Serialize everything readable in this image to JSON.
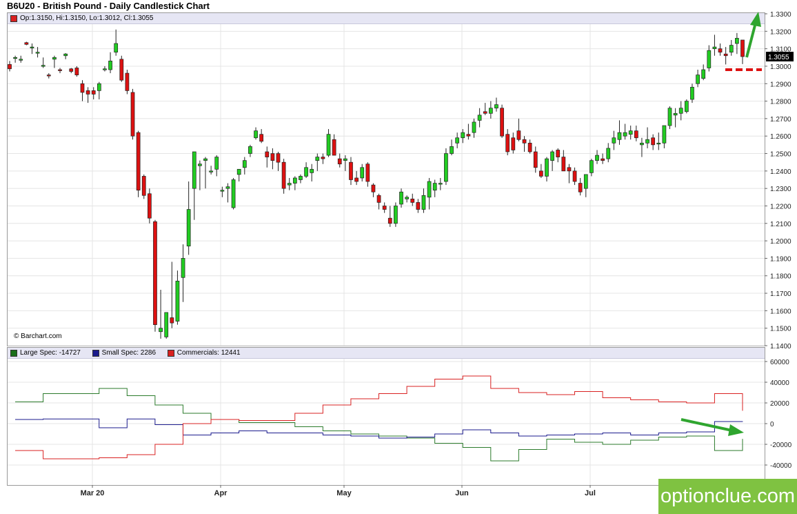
{
  "header": {
    "title": "B6U20 - British Pound - Daily Candlestick Chart"
  },
  "price_legend": {
    "label": "Op:1.3150, Hi:1.3150, Lo:1.3012, Cl:1.3055",
    "color": "#d92020"
  },
  "last_price_label": "1.3055",
  "copyright": "© Barchart.com",
  "cot_legend": [
    {
      "label": "Large Spec: -14727",
      "color": "#1a6e1a"
    },
    {
      "label": "Small Spec: 2286",
      "color": "#1a1a8c"
    },
    {
      "label": "Commercials: 12441",
      "color": "#d92020"
    }
  ],
  "brand": "optionclue.com",
  "colors": {
    "up": "#22cc22",
    "down": "#dd1111",
    "large": "#2a7a2a",
    "small": "#1a1a8c",
    "comm": "#d92020",
    "arrow": "#2fa52f"
  },
  "chart_data": [
    {
      "type": "candlestick",
      "x_tick_labels": [
        "Mar 20",
        "Apr",
        "May",
        "Jun",
        "Jul"
      ],
      "y_ticks": [
        "1.3300",
        "1.3200",
        "1.3100",
        "1.3000",
        "1.2900",
        "1.2800",
        "1.2700",
        "1.2600",
        "1.2500",
        "1.2400",
        "1.2300",
        "1.2200",
        "1.2100",
        "1.2000",
        "1.1900",
        "1.1800",
        "1.1700",
        "1.1600",
        "1.1500",
        "1.1400"
      ],
      "ylim": [
        1.14,
        1.33
      ],
      "candles": [
        {
          "o": 1.301,
          "h": 1.303,
          "l": 1.297,
          "c": 1.2985
        },
        {
          "o": 1.3045,
          "h": 1.306,
          "l": 1.302,
          "c": 1.305
        },
        {
          "o": 1.3035,
          "h": 1.306,
          "l": 1.302,
          "c": 1.304
        },
        {
          "o": 1.3135,
          "h": 1.314,
          "l": 1.312,
          "c": 1.3125
        },
        {
          "o": 1.3105,
          "h": 1.313,
          "l": 1.307,
          "c": 1.311
        },
        {
          "o": 1.3075,
          "h": 1.311,
          "l": 1.305,
          "c": 1.308
        },
        {
          "o": 1.3,
          "h": 1.305,
          "l": 1.299,
          "c": 1.3005
        },
        {
          "o": 1.295,
          "h": 1.296,
          "l": 1.293,
          "c": 1.2945
        },
        {
          "o": 1.304,
          "h": 1.306,
          "l": 1.299,
          "c": 1.305
        },
        {
          "o": 1.298,
          "h": 1.299,
          "l": 1.296,
          "c": 1.2975
        },
        {
          "o": 1.306,
          "h": 1.3075,
          "l": 1.304,
          "c": 1.307
        },
        {
          "o": 1.2985,
          "h": 1.299,
          "l": 1.296,
          "c": 1.297
        },
        {
          "o": 1.299,
          "h": 1.3,
          "l": 1.294,
          "c": 1.295
        },
        {
          "o": 1.29,
          "h": 1.292,
          "l": 1.28,
          "c": 1.285
        },
        {
          "o": 1.286,
          "h": 1.288,
          "l": 1.279,
          "c": 1.284
        },
        {
          "o": 1.286,
          "h": 1.288,
          "l": 1.281,
          "c": 1.284
        },
        {
          "o": 1.286,
          "h": 1.291,
          "l": 1.281,
          "c": 1.29
        },
        {
          "o": 1.298,
          "h": 1.3,
          "l": 1.297,
          "c": 1.2985
        },
        {
          "o": 1.298,
          "h": 1.308,
          "l": 1.296,
          "c": 1.303
        },
        {
          "o": 1.308,
          "h": 1.321,
          "l": 1.306,
          "c": 1.313
        },
        {
          "o": 1.304,
          "h": 1.306,
          "l": 1.291,
          "c": 1.292
        },
        {
          "o": 1.296,
          "h": 1.298,
          "l": 1.284,
          "c": 1.286
        },
        {
          "o": 1.285,
          "h": 1.287,
          "l": 1.258,
          "c": 1.26
        },
        {
          "o": 1.262,
          "h": 1.263,
          "l": 1.225,
          "c": 1.229
        },
        {
          "o": 1.237,
          "h": 1.238,
          "l": 1.224,
          "c": 1.226
        },
        {
          "o": 1.227,
          "h": 1.23,
          "l": 1.21,
          "c": 1.213
        },
        {
          "o": 1.211,
          "h": 1.212,
          "l": 1.148,
          "c": 1.152
        },
        {
          "o": 1.148,
          "h": 1.172,
          "l": 1.144,
          "c": 1.15
        },
        {
          "o": 1.145,
          "h": 1.158,
          "l": 1.144,
          "c": 1.159
        },
        {
          "o": 1.156,
          "h": 1.188,
          "l": 1.15,
          "c": 1.153
        },
        {
          "o": 1.154,
          "h": 1.183,
          "l": 1.152,
          "c": 1.177
        },
        {
          "o": 1.179,
          "h": 1.198,
          "l": 1.165,
          "c": 1.19
        },
        {
          "o": 1.197,
          "h": 1.234,
          "l": 1.192,
          "c": 1.218
        },
        {
          "o": 1.23,
          "h": 1.251,
          "l": 1.212,
          "c": 1.251
        },
        {
          "o": 1.243,
          "h": 1.246,
          "l": 1.229,
          "c": 1.244
        },
        {
          "o": 1.246,
          "h": 1.248,
          "l": 1.23,
          "c": 1.247
        },
        {
          "o": 1.24,
          "h": 1.243,
          "l": 1.238,
          "c": 1.24
        },
        {
          "o": 1.241,
          "h": 1.249,
          "l": 1.237,
          "c": 1.248
        },
        {
          "o": 1.229,
          "h": 1.231,
          "l": 1.225,
          "c": 1.229
        },
        {
          "o": 1.23,
          "h": 1.233,
          "l": 1.222,
          "c": 1.231
        },
        {
          "o": 1.219,
          "h": 1.236,
          "l": 1.218,
          "c": 1.235
        },
        {
          "o": 1.238,
          "h": 1.241,
          "l": 1.234,
          "c": 1.241
        },
        {
          "o": 1.242,
          "h": 1.248,
          "l": 1.238,
          "c": 1.246
        },
        {
          "o": 1.25,
          "h": 1.255,
          "l": 1.248,
          "c": 1.254
        },
        {
          "o": 1.259,
          "h": 1.265,
          "l": 1.258,
          "c": 1.263
        },
        {
          "o": 1.261,
          "h": 1.264,
          "l": 1.256,
          "c": 1.257
        },
        {
          "o": 1.251,
          "h": 1.254,
          "l": 1.242,
          "c": 1.248
        },
        {
          "o": 1.25,
          "h": 1.253,
          "l": 1.241,
          "c": 1.246
        },
        {
          "o": 1.25,
          "h": 1.251,
          "l": 1.24,
          "c": 1.245
        },
        {
          "o": 1.245,
          "h": 1.247,
          "l": 1.227,
          "c": 1.23
        },
        {
          "o": 1.232,
          "h": 1.236,
          "l": 1.229,
          "c": 1.233
        },
        {
          "o": 1.233,
          "h": 1.237,
          "l": 1.229,
          "c": 1.236
        },
        {
          "o": 1.235,
          "h": 1.238,
          "l": 1.233,
          "c": 1.237
        },
        {
          "o": 1.237,
          "h": 1.245,
          "l": 1.236,
          "c": 1.242
        },
        {
          "o": 1.239,
          "h": 1.244,
          "l": 1.234,
          "c": 1.241
        },
        {
          "o": 1.246,
          "h": 1.25,
          "l": 1.24,
          "c": 1.248
        },
        {
          "o": 1.248,
          "h": 1.25,
          "l": 1.244,
          "c": 1.247
        },
        {
          "o": 1.249,
          "h": 1.264,
          "l": 1.248,
          "c": 1.261
        },
        {
          "o": 1.258,
          "h": 1.261,
          "l": 1.249,
          "c": 1.249
        },
        {
          "o": 1.247,
          "h": 1.25,
          "l": 1.242,
          "c": 1.244
        },
        {
          "o": 1.246,
          "h": 1.249,
          "l": 1.24,
          "c": 1.247
        },
        {
          "o": 1.245,
          "h": 1.248,
          "l": 1.232,
          "c": 1.235
        },
        {
          "o": 1.236,
          "h": 1.24,
          "l": 1.232,
          "c": 1.234
        },
        {
          "o": 1.236,
          "h": 1.244,
          "l": 1.234,
          "c": 1.242
        },
        {
          "o": 1.244,
          "h": 1.245,
          "l": 1.231,
          "c": 1.234
        },
        {
          "o": 1.232,
          "h": 1.233,
          "l": 1.225,
          "c": 1.228
        },
        {
          "o": 1.226,
          "h": 1.227,
          "l": 1.218,
          "c": 1.222
        },
        {
          "o": 1.22,
          "h": 1.222,
          "l": 1.216,
          "c": 1.218
        },
        {
          "o": 1.213,
          "h": 1.22,
          "l": 1.208,
          "c": 1.21
        },
        {
          "o": 1.21,
          "h": 1.222,
          "l": 1.208,
          "c": 1.22
        },
        {
          "o": 1.221,
          "h": 1.23,
          "l": 1.219,
          "c": 1.228
        },
        {
          "o": 1.224,
          "h": 1.226,
          "l": 1.222,
          "c": 1.225
        },
        {
          "o": 1.224,
          "h": 1.227,
          "l": 1.22,
          "c": 1.222
        },
        {
          "o": 1.222,
          "h": 1.224,
          "l": 1.216,
          "c": 1.218
        },
        {
          "o": 1.218,
          "h": 1.23,
          "l": 1.216,
          "c": 1.226
        },
        {
          "o": 1.225,
          "h": 1.236,
          "l": 1.218,
          "c": 1.234
        },
        {
          "o": 1.229,
          "h": 1.235,
          "l": 1.225,
          "c": 1.233
        },
        {
          "o": 1.233,
          "h": 1.236,
          "l": 1.229,
          "c": 1.233
        },
        {
          "o": 1.234,
          "h": 1.253,
          "l": 1.232,
          "c": 1.25
        },
        {
          "o": 1.25,
          "h": 1.258,
          "l": 1.249,
          "c": 1.254
        },
        {
          "o": 1.256,
          "h": 1.262,
          "l": 1.253,
          "c": 1.259
        },
        {
          "o": 1.259,
          "h": 1.264,
          "l": 1.256,
          "c": 1.262
        },
        {
          "o": 1.261,
          "h": 1.267,
          "l": 1.258,
          "c": 1.26
        },
        {
          "o": 1.262,
          "h": 1.27,
          "l": 1.259,
          "c": 1.268
        },
        {
          "o": 1.269,
          "h": 1.276,
          "l": 1.265,
          "c": 1.272
        },
        {
          "o": 1.274,
          "h": 1.279,
          "l": 1.272,
          "c": 1.273
        },
        {
          "o": 1.273,
          "h": 1.28,
          "l": 1.27,
          "c": 1.276
        },
        {
          "o": 1.276,
          "h": 1.282,
          "l": 1.274,
          "c": 1.278
        },
        {
          "o": 1.276,
          "h": 1.278,
          "l": 1.259,
          "c": 1.26
        },
        {
          "o": 1.261,
          "h": 1.264,
          "l": 1.249,
          "c": 1.251
        },
        {
          "o": 1.259,
          "h": 1.262,
          "l": 1.25,
          "c": 1.252
        },
        {
          "o": 1.263,
          "h": 1.27,
          "l": 1.257,
          "c": 1.258
        },
        {
          "o": 1.258,
          "h": 1.26,
          "l": 1.251,
          "c": 1.256
        },
        {
          "o": 1.256,
          "h": 1.258,
          "l": 1.25,
          "c": 1.251
        },
        {
          "o": 1.251,
          "h": 1.254,
          "l": 1.239,
          "c": 1.242
        },
        {
          "o": 1.24,
          "h": 1.244,
          "l": 1.236,
          "c": 1.237
        },
        {
          "o": 1.237,
          "h": 1.248,
          "l": 1.234,
          "c": 1.247
        },
        {
          "o": 1.246,
          "h": 1.252,
          "l": 1.24,
          "c": 1.251
        },
        {
          "o": 1.252,
          "h": 1.253,
          "l": 1.245,
          "c": 1.248
        },
        {
          "o": 1.248,
          "h": 1.252,
          "l": 1.24,
          "c": 1.24
        },
        {
          "o": 1.242,
          "h": 1.244,
          "l": 1.233,
          "c": 1.24
        },
        {
          "o": 1.24,
          "h": 1.242,
          "l": 1.232,
          "c": 1.234
        },
        {
          "o": 1.233,
          "h": 1.236,
          "l": 1.226,
          "c": 1.228
        },
        {
          "o": 1.23,
          "h": 1.238,
          "l": 1.225,
          "c": 1.238
        },
        {
          "o": 1.239,
          "h": 1.247,
          "l": 1.237,
          "c": 1.246
        },
        {
          "o": 1.246,
          "h": 1.252,
          "l": 1.244,
          "c": 1.249
        },
        {
          "o": 1.247,
          "h": 1.25,
          "l": 1.244,
          "c": 1.246
        },
        {
          "o": 1.247,
          "h": 1.256,
          "l": 1.245,
          "c": 1.253
        },
        {
          "o": 1.256,
          "h": 1.263,
          "l": 1.252,
          "c": 1.259
        },
        {
          "o": 1.258,
          "h": 1.269,
          "l": 1.255,
          "c": 1.262
        },
        {
          "o": 1.26,
          "h": 1.267,
          "l": 1.258,
          "c": 1.262
        },
        {
          "o": 1.261,
          "h": 1.266,
          "l": 1.258,
          "c": 1.263
        },
        {
          "o": 1.263,
          "h": 1.266,
          "l": 1.257,
          "c": 1.259
        },
        {
          "o": 1.255,
          "h": 1.259,
          "l": 1.248,
          "c": 1.256
        },
        {
          "o": 1.256,
          "h": 1.265,
          "l": 1.253,
          "c": 1.258
        },
        {
          "o": 1.259,
          "h": 1.261,
          "l": 1.252,
          "c": 1.255
        },
        {
          "o": 1.256,
          "h": 1.262,
          "l": 1.252,
          "c": 1.256
        },
        {
          "o": 1.256,
          "h": 1.264,
          "l": 1.253,
          "c": 1.266
        },
        {
          "o": 1.266,
          "h": 1.277,
          "l": 1.264,
          "c": 1.276
        },
        {
          "o": 1.272,
          "h": 1.276,
          "l": 1.265,
          "c": 1.273
        },
        {
          "o": 1.273,
          "h": 1.28,
          "l": 1.269,
          "c": 1.276
        },
        {
          "o": 1.274,
          "h": 1.281,
          "l": 1.273,
          "c": 1.28
        },
        {
          "o": 1.281,
          "h": 1.29,
          "l": 1.279,
          "c": 1.288
        },
        {
          "o": 1.29,
          "h": 1.298,
          "l": 1.288,
          "c": 1.295
        },
        {
          "o": 1.293,
          "h": 1.301,
          "l": 1.292,
          "c": 1.298
        },
        {
          "o": 1.299,
          "h": 1.312,
          "l": 1.297,
          "c": 1.309
        },
        {
          "o": 1.31,
          "h": 1.318,
          "l": 1.306,
          "c": 1.311
        },
        {
          "o": 1.31,
          "h": 1.313,
          "l": 1.306,
          "c": 1.308
        },
        {
          "o": 1.307,
          "h": 1.311,
          "l": 1.301,
          "c": 1.306
        },
        {
          "o": 1.308,
          "h": 1.315,
          "l": 1.306,
          "c": 1.312
        },
        {
          "o": 1.313,
          "h": 1.319,
          "l": 1.307,
          "c": 1.316
        },
        {
          "o": 1.315,
          "h": 1.315,
          "l": 1.3012,
          "c": 1.3055
        }
      ]
    },
    {
      "type": "line",
      "x_tick_labels": [
        "Mar 20",
        "Apr",
        "May",
        "Jun",
        "Jul"
      ],
      "y_ticks": [
        "60000",
        "40000",
        "20000",
        "0",
        "-20000",
        "-40000"
      ],
      "ylim": [
        -60000,
        65000
      ],
      "series": [
        {
          "name": "Large Spec",
          "values": [
            21000,
            29000,
            29000,
            34000,
            27000,
            18000,
            10000,
            4000,
            1000,
            1000,
            -3000,
            -7000,
            -10000,
            -12000,
            -14000,
            -19000,
            -23000,
            -36000,
            -25000,
            -15000,
            -18000,
            -20000,
            -16000,
            -13000,
            -12000,
            -26000,
            -14727
          ]
        },
        {
          "name": "Small Spec",
          "values": [
            4000,
            4500,
            4500,
            -4000,
            4500,
            -1000,
            -11000,
            -9000,
            -7000,
            -9000,
            -9000,
            -11000,
            -12000,
            -14000,
            -13000,
            -10000,
            -6000,
            -9000,
            -12000,
            -11000,
            -10000,
            -9000,
            -11000,
            -9000,
            -8000,
            2000,
            2286
          ]
        },
        {
          "name": "Commercials",
          "values": [
            -26000,
            -34000,
            -34000,
            -33000,
            -30000,
            -20000,
            0,
            4000,
            3000,
            3000,
            10000,
            18000,
            24000,
            29000,
            36000,
            43000,
            46000,
            34000,
            30000,
            28000,
            31000,
            25000,
            23000,
            21000,
            20000,
            29000,
            12441
          ]
        }
      ]
    }
  ]
}
